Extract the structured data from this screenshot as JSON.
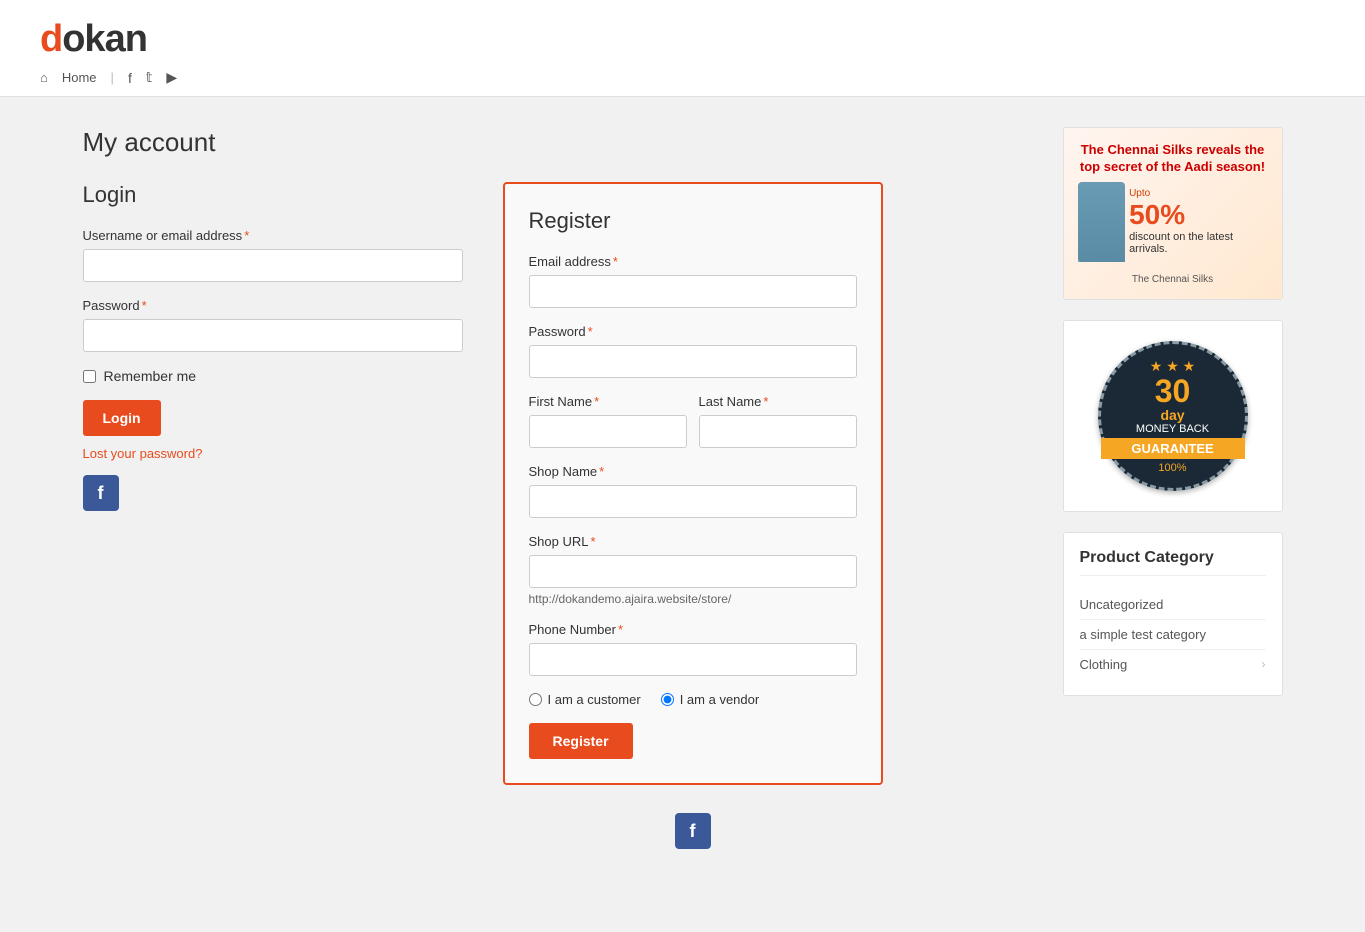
{
  "site": {
    "logo_prefix": "d",
    "logo_rest": "okan",
    "nav": {
      "home": "Home",
      "social": [
        "f",
        "t",
        "y"
      ]
    }
  },
  "page": {
    "title": "My account"
  },
  "login": {
    "section_title": "Login",
    "username_label": "Username or email address",
    "username_required": "*",
    "password_label": "Password",
    "password_required": "*",
    "remember_label": "Remember me",
    "login_button": "Login",
    "lost_password": "Lost your password?",
    "fb_button": "f"
  },
  "register": {
    "section_title": "Register",
    "email_label": "Email address",
    "email_required": "*",
    "password_label": "Password",
    "password_required": "*",
    "firstname_label": "First Name",
    "firstname_required": "*",
    "lastname_label": "Last Name",
    "lastname_required": "*",
    "shopname_label": "Shop Name",
    "shopname_required": "*",
    "shopurl_label": "Shop URL",
    "shopurl_required": "*",
    "shopurl_hint": "http://dokandemo.ajaira.website/store/",
    "phone_label": "Phone Number",
    "phone_required": "*",
    "customer_label": "I am a customer",
    "vendor_label": "I am a vendor",
    "register_button": "Register",
    "fb_button": "f"
  },
  "sidebar": {
    "ad": {
      "title": "The Chennai Silks reveals the top secret of the Aadi season!",
      "discount": "50%",
      "discount_text": "discount on the latest arrivals.",
      "brand": "The Chennai Silks"
    },
    "guarantee": {
      "days": "30",
      "day_word": "day",
      "money": "MONEY BACK",
      "guarantee": "GUARANTEE",
      "pct": "100%",
      "stars": [
        "★",
        "★",
        "★"
      ]
    },
    "product_category": {
      "title": "Product Category",
      "items": [
        {
          "label": "Uncategorized",
          "has_arrow": false
        },
        {
          "label": "a simple test category",
          "has_arrow": false
        },
        {
          "label": "Clothing",
          "has_arrow": true
        }
      ]
    }
  }
}
